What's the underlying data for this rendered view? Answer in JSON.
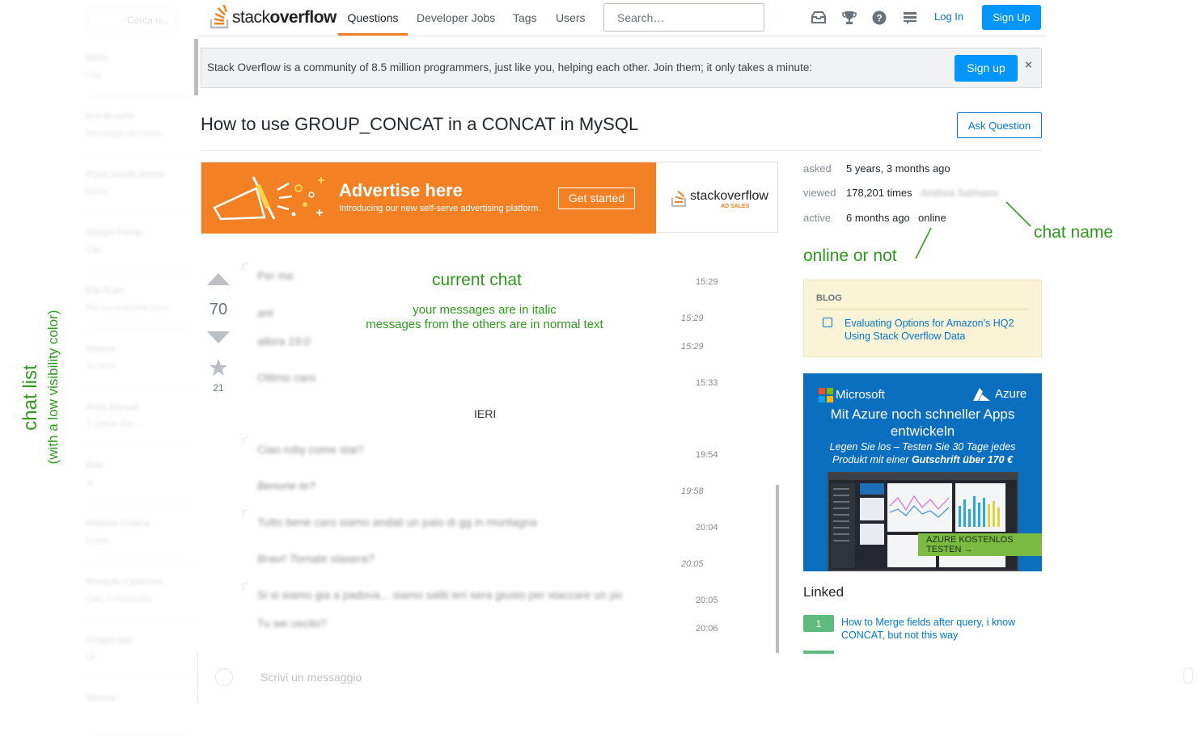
{
  "chat_list": {
    "search_placeholder": "Cerca o...",
    "items": [
      {
        "name": "Mirko",
        "preview": "Foto"
      },
      {
        "name": "Ervi Bruschi",
        "preview": "Messaggio tipo audio"
      },
      {
        "name": "Pizza Venditi Arrosti",
        "preview": "Marco"
      },
      {
        "name": "Giorgio Ferrari",
        "preview": "Ciao"
      },
      {
        "name": "Elia Ruim",
        "preview": "Per me andrebbe bene..."
      },
      {
        "name": "Simone",
        "preview": "Va bene"
      },
      {
        "name": "Anna Manuel",
        "preview": "Ti volevo dire..."
      },
      {
        "name": "Babi",
        "preview": "ok"
      },
      {
        "name": "Roberta Cristina",
        "preview": "Grazie"
      },
      {
        "name": "Riccardo Casseuse",
        "preview": "Ciao, ti volevo dire"
      },
      {
        "name": "Gruppo gigi",
        "preview": "Ok"
      },
      {
        "name": "Simone",
        "preview": ""
      }
    ]
  },
  "topbar": {
    "logo": {
      "prefix": "stack",
      "suffix": "overflow"
    },
    "nav": [
      "Questions",
      "Developer Jobs",
      "Tags",
      "Users"
    ],
    "search_placeholder": "Search…",
    "login": "Log In",
    "signup": "Sign Up"
  },
  "banner": {
    "text": "Stack Overflow is a community of 8.5 million programmers, just like you, helping each other. Join them; it only takes a minute:",
    "button": "Sign up",
    "close": "×"
  },
  "question": {
    "title": "How to use GROUP_CONCAT in a CONCAT in MySQL",
    "ask_button": "Ask Question",
    "votes": "70",
    "favorites": "21"
  },
  "ad": {
    "headline": "Advertise here",
    "subline": "Introducing our new self-serve advertising platform.",
    "button": "Get started",
    "brand": "stackoverflow",
    "brand_sub": "AD SALES"
  },
  "stats": {
    "asked_label": "asked",
    "asked_value": "5 years, 3 months ago",
    "viewed_label": "viewed",
    "viewed_value": "178,201 times",
    "active_label": "active",
    "active_value": "6 months ago",
    "contact_name": "Andrea Salmaso",
    "online_status": "online"
  },
  "annotations": {
    "chat_name": "chat name",
    "online_or_not": "online or not",
    "current_chat": "current chat",
    "italic_note_1": "your messages are in italic",
    "italic_note_2": "messages from the others are in normal text",
    "chat_list_1": "chat list",
    "chat_list_2": "(with a low visibility color)"
  },
  "chat": {
    "day_separator": "IERI",
    "messages": [
      {
        "text": "Per me",
        "time": "15:29",
        "mine": false
      },
      {
        "text": "ant",
        "time": "15:29",
        "mine": true
      },
      {
        "text": "allora 19:0",
        "time": "15:29",
        "mine": true
      },
      {
        "text": "Ottimo caro",
        "time": "15:33",
        "mine": false
      },
      {
        "text": "Ciao roby come stai?",
        "time": "19:54",
        "mine": false
      },
      {
        "text": "Benone te?",
        "time": "19:58",
        "mine": true
      },
      {
        "text": "Tutto bene caro siamo andati un paio di gg in montagna",
        "time": "20:04",
        "mine": false
      },
      {
        "text": "Bravi! Tornate stasera?",
        "time": "20:05",
        "mine": true
      },
      {
        "text": "Si si siamo gia a padova... siamo saliti ieri sera giusto per staccare un po",
        "time": "20:05",
        "mine": false
      },
      {
        "text": "Tu sei uscito?",
        "time": "20:06",
        "mine": false
      }
    ],
    "composer_placeholder": "Scrivi un messaggio"
  },
  "blog": {
    "heading": "BLOG",
    "link": "Evaluating Options for Amazon's HQ2 Using Stack Overflow Data"
  },
  "azure_ad": {
    "microsoft": "Microsoft",
    "azure": "Azure",
    "headline": "Mit Azure noch schneller Apps entwickeln",
    "subline_1": "Legen Sie los – Testen Sie 30 Tage jedes",
    "subline_2_prefix": "Produkt mit einer ",
    "subline_2_bold": "Gutschrift über 170 €",
    "cta": "AZURE KOSTENLOS TESTEN",
    "cta_arrow": "→"
  },
  "linked": {
    "heading": "Linked",
    "items": [
      {
        "score": "1",
        "title": "How to Merge fields after query, i know CONCAT, but not this way"
      }
    ]
  },
  "colors": {
    "accent_orange": "#f48024",
    "link_blue": "#0077cc",
    "button_blue": "#0095ff",
    "annotation_green": "#2e9a1c"
  }
}
